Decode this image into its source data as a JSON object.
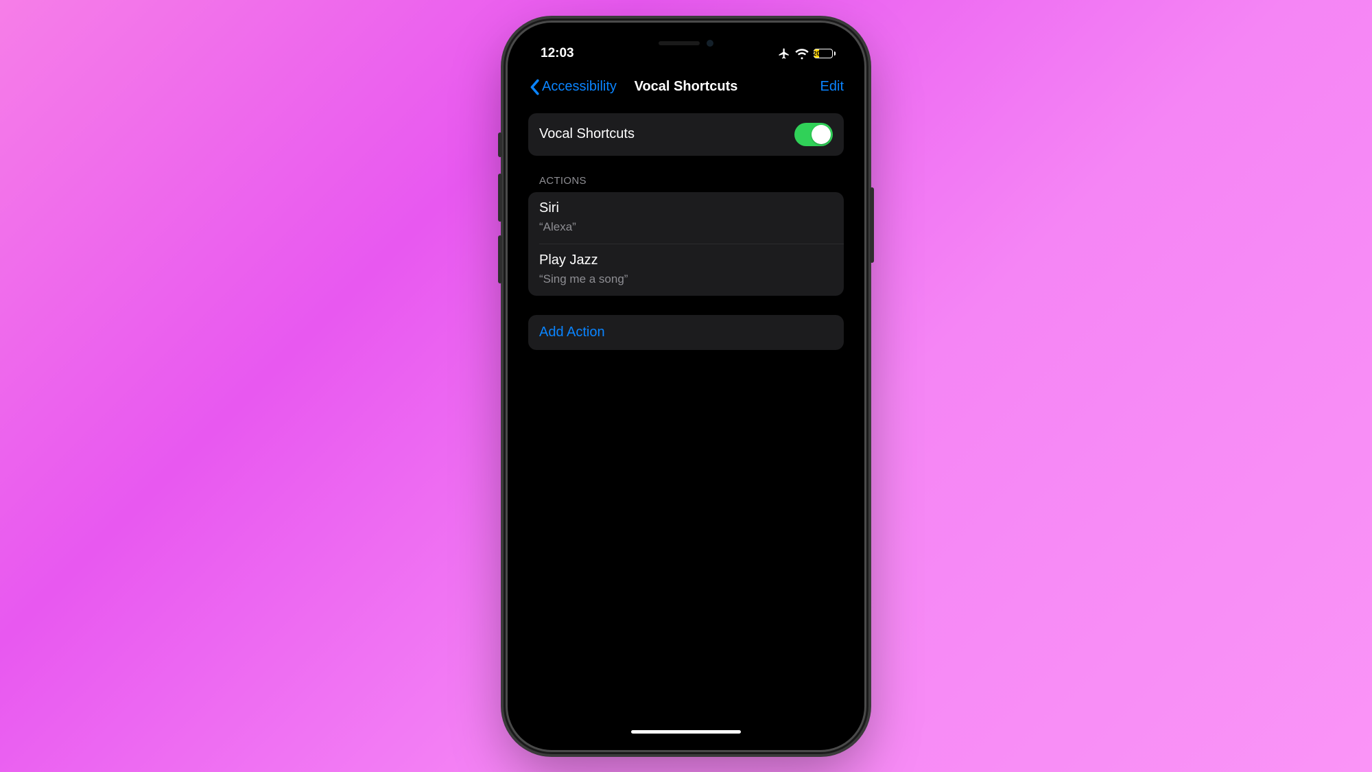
{
  "statusbar": {
    "time": "12:03",
    "battery_percent": "20"
  },
  "navbar": {
    "back_label": "Accessibility",
    "title": "Vocal Shortcuts",
    "edit_label": "Edit"
  },
  "main_toggle": {
    "label": "Vocal Shortcuts",
    "on": true
  },
  "actions_header": "Actions",
  "actions": [
    {
      "title": "Siri",
      "phrase": "“Alexa”"
    },
    {
      "title": "Play Jazz",
      "phrase": "“Sing me a song”"
    }
  ],
  "add_action_label": "Add Action"
}
